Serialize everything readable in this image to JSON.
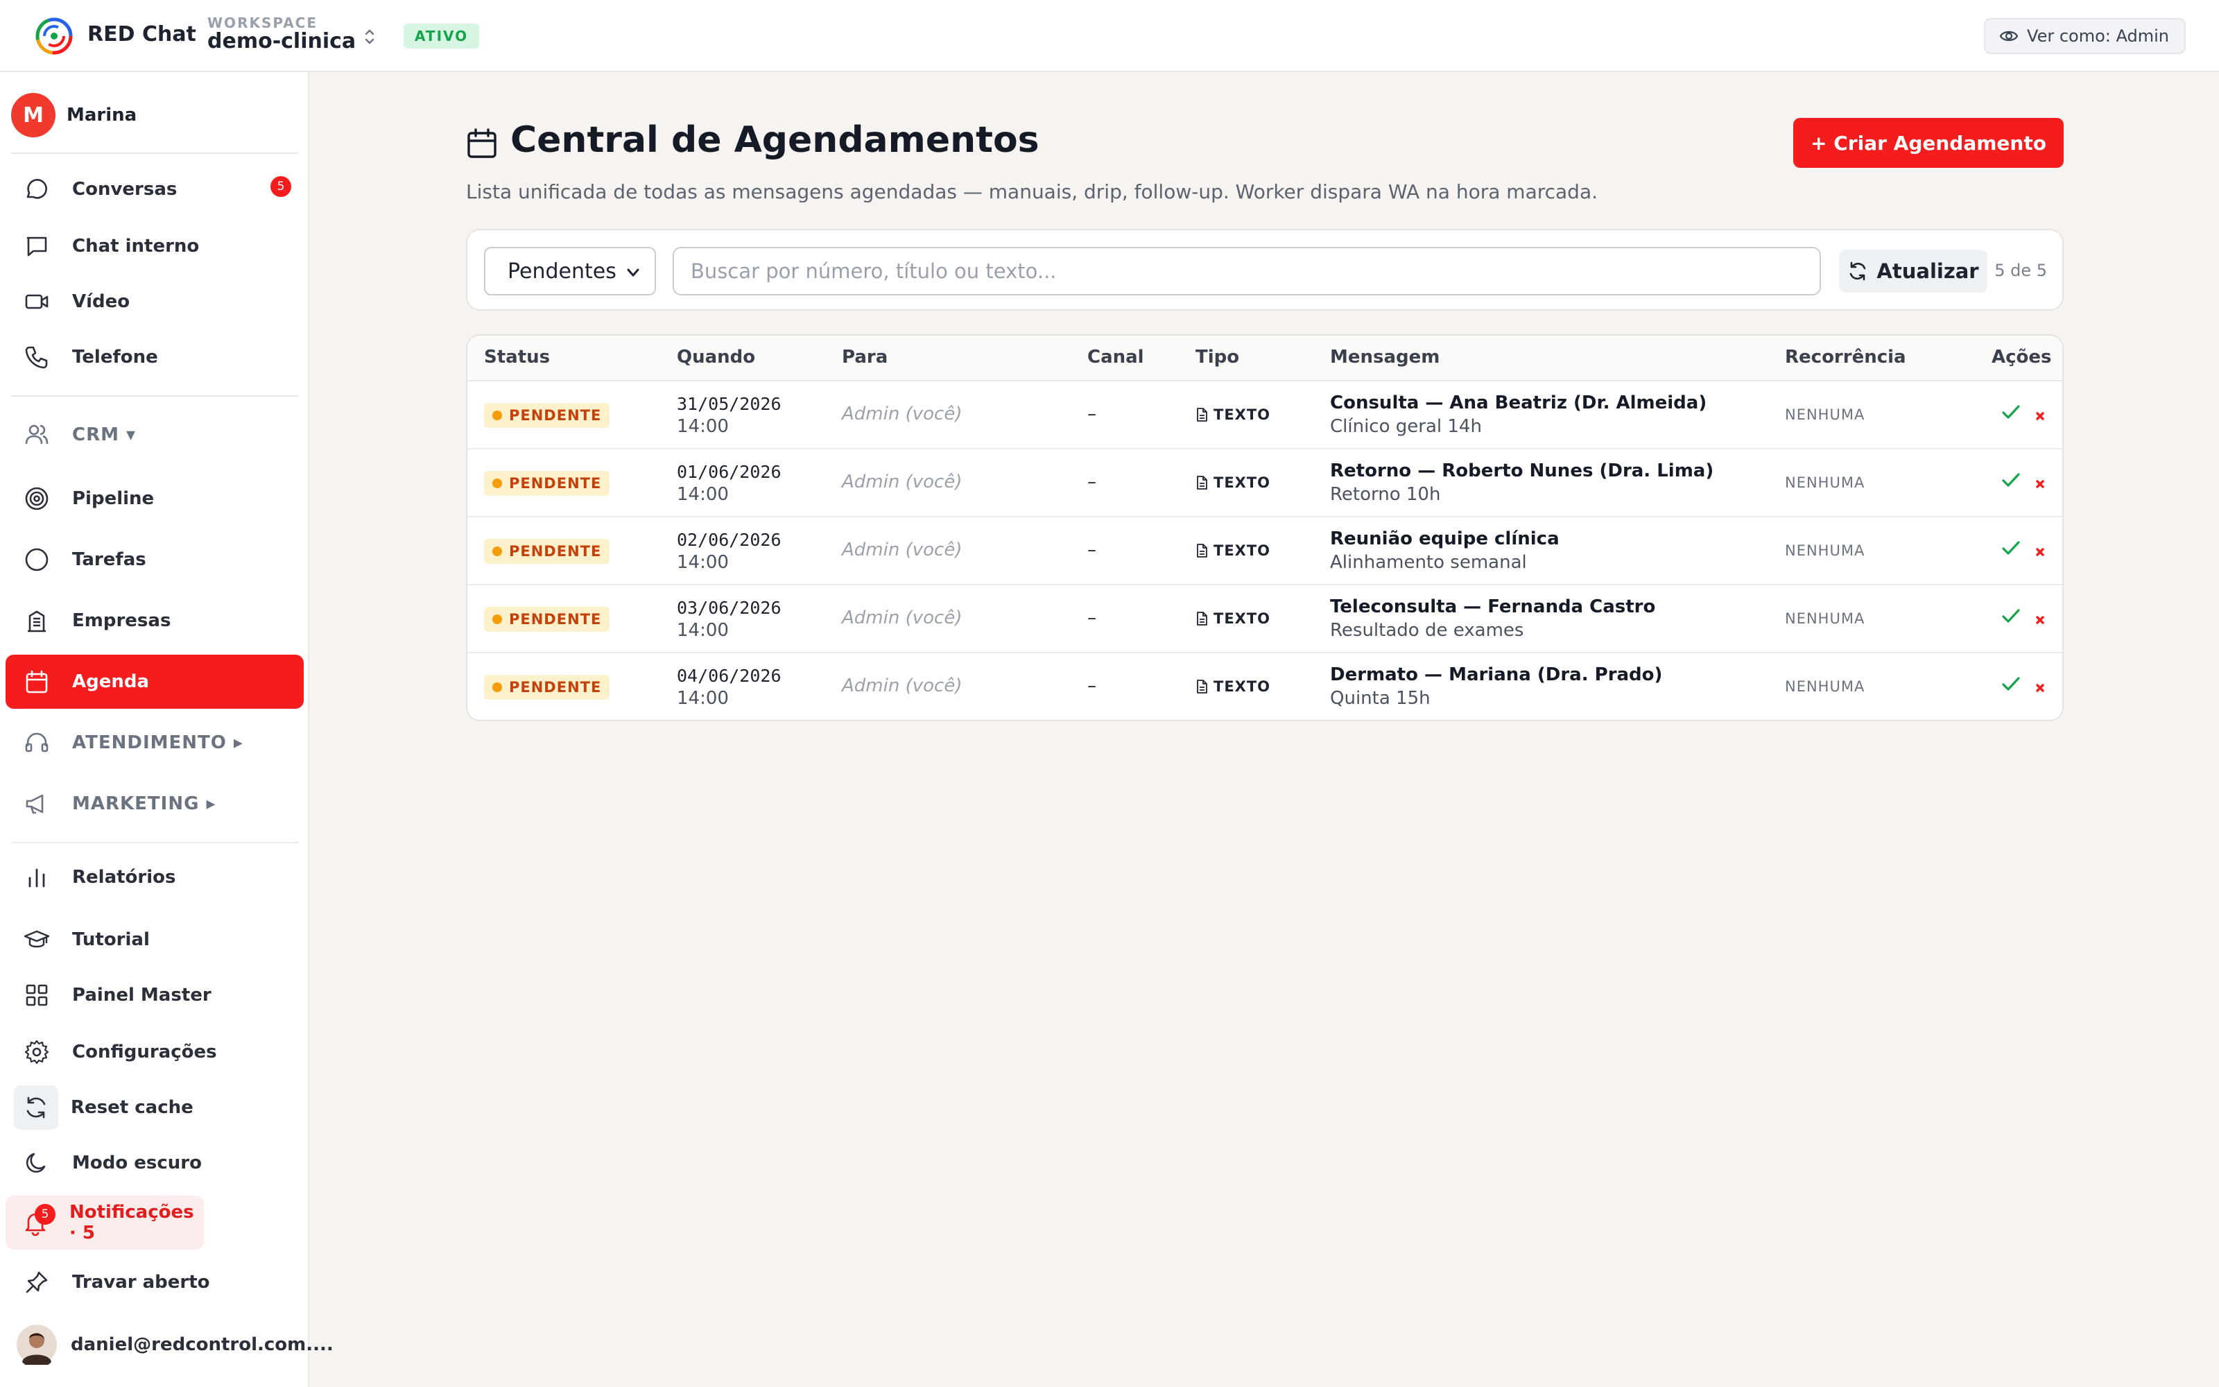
{
  "topbar": {
    "brand": "RED Chat",
    "workspace_label": "WORKSPACE",
    "workspace_name": "demo-clinica",
    "status_badge": "ATIVO",
    "view_as": "Ver como: Admin"
  },
  "sidebar": {
    "user_initial": "M",
    "user_name": "Marina",
    "items": [
      {
        "label": "Conversas",
        "icon": "chat-bubble-icon",
        "badge": "5"
      },
      {
        "label": "Chat interno",
        "icon": "message-square-icon"
      },
      {
        "label": "Vídeo",
        "icon": "video-camera-icon"
      },
      {
        "label": "Telefone",
        "icon": "phone-icon"
      },
      {
        "label": "CRM ▾",
        "icon": "users-icon"
      },
      {
        "label": "Pipeline",
        "icon": "target-icon"
      },
      {
        "label": "Tarefas",
        "icon": "circle-icon"
      },
      {
        "label": "Empresas",
        "icon": "building-icon"
      },
      {
        "label": "Agenda",
        "icon": "calendar-icon"
      },
      {
        "label": "ATENDIMENTO ▸",
        "icon": "headset-icon"
      },
      {
        "label": "MARKETING ▸",
        "icon": "megaphone-icon"
      },
      {
        "label": "Relatórios",
        "icon": "bar-chart-icon"
      },
      {
        "label": "Tutorial",
        "icon": "graduation-cap-icon"
      },
      {
        "label": "Painel Master",
        "icon": "grid-icon"
      },
      {
        "label": "Configurações",
        "icon": "gear-icon"
      },
      {
        "label": "Reset cache",
        "icon": "refresh-icon"
      },
      {
        "label": "Modo escuro",
        "icon": "moon-icon"
      },
      {
        "label": "Notificações · 5",
        "icon": "bell-icon",
        "badge": "5"
      },
      {
        "label": "Travar aberto",
        "icon": "pin-icon"
      },
      {
        "label": "daniel@redcontrol.com....",
        "icon": "user-avatar"
      }
    ]
  },
  "main": {
    "title": "Central de Agendamentos",
    "subtitle": "Lista unificada de todas as mensagens agendadas — manuais, drip, follow-up. Worker dispara WA na hora marcada.",
    "create_button": "+ Criar Agendamento",
    "filter_value": "Pendentes",
    "search_placeholder": "Buscar por número, título ou texto...",
    "refresh_label": "Atualizar",
    "count_text": "5 de 5",
    "columns": [
      "Status",
      "Quando",
      "Para",
      "Canal",
      "Tipo",
      "Mensagem",
      "Recorrência",
      "Ações"
    ],
    "rows": [
      {
        "status": "PENDENTE",
        "date": "31/05/2026",
        "time": "14:00",
        "to": "Admin (você)",
        "channel": "–",
        "type": "TEXTO",
        "title": "Consulta — Ana Beatriz (Dr. Almeida)",
        "body": "Clínico geral 14h",
        "recurrence": "NENHUMA"
      },
      {
        "status": "PENDENTE",
        "date": "01/06/2026",
        "time": "14:00",
        "to": "Admin (você)",
        "channel": "–",
        "type": "TEXTO",
        "title": "Retorno — Roberto Nunes (Dra. Lima)",
        "body": "Retorno 10h",
        "recurrence": "NENHUMA"
      },
      {
        "status": "PENDENTE",
        "date": "02/06/2026",
        "time": "14:00",
        "to": "Admin (você)",
        "channel": "–",
        "type": "TEXTO",
        "title": "Reunião equipe clínica",
        "body": "Alinhamento semanal",
        "recurrence": "NENHUMA"
      },
      {
        "status": "PENDENTE",
        "date": "03/06/2026",
        "time": "14:00",
        "to": "Admin (você)",
        "channel": "–",
        "type": "TEXTO",
        "title": "Teleconsulta — Fernanda Castro",
        "body": "Resultado de exames",
        "recurrence": "NENHUMA"
      },
      {
        "status": "PENDENTE",
        "date": "04/06/2026",
        "time": "14:00",
        "to": "Admin (você)",
        "channel": "–",
        "type": "TEXTO",
        "title": "Dermato — Mariana (Dra. Prado)",
        "body": "Quinta 15h",
        "recurrence": "NENHUMA"
      }
    ]
  },
  "colors": {
    "accent": "#f41c1c",
    "pending_bg": "#fdf1cc",
    "pending_text": "#c2410c",
    "success": "#16a34a"
  }
}
